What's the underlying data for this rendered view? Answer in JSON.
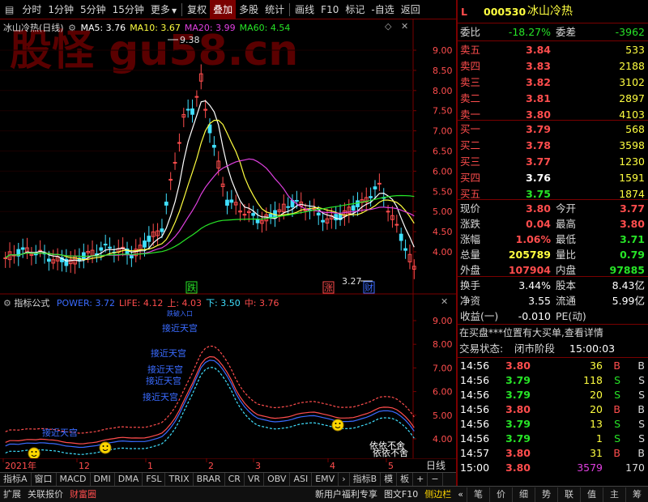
{
  "toolbar": {
    "items": [
      "分时",
      "1分钟",
      "5分钟",
      "15分钟",
      "更多",
      "复权",
      "叠加",
      "多股",
      "统计",
      "画线",
      "F10",
      "标记",
      "-自选",
      "返回"
    ],
    "active_index": 6
  },
  "main_chart": {
    "title": "冰山冷热(日线)",
    "ma": [
      {
        "label": "MA5: 3.76",
        "color": "#ffffff"
      },
      {
        "label": "MA10: 3.67",
        "color": "#ffff40"
      },
      {
        "label": "MA20: 3.99",
        "color": "#e040e0"
      },
      {
        "label": "MA60: 4.54",
        "color": "#27e427"
      }
    ],
    "y_ticks": [
      "9.00",
      "8.50",
      "8.00",
      "7.50",
      "7.00",
      "6.50",
      "6.00",
      "5.50",
      "5.00",
      "4.50",
      "4.00"
    ],
    "high_label": "9.38",
    "low_label": "3.27",
    "badges": [
      "跌",
      "涨",
      "财"
    ],
    "watermark": "股怪 gu58.cn"
  },
  "indicator_chart": {
    "title": "指标公式",
    "values": [
      {
        "label": "POWER: 3.72",
        "color": "#3a6bff"
      },
      {
        "label": "LIFE: 4.12",
        "color": "#ff4d4d"
      },
      {
        "label": "上: 4.03",
        "color": "#ff4d4d"
      },
      {
        "label": "下: 3.50",
        "color": "#40e0ff"
      },
      {
        "label": "中: 3.76",
        "color": "#ff4d4d"
      }
    ],
    "y_ticks": [
      "9.00",
      "8.00",
      "7.00",
      "6.00",
      "5.00",
      "4.00"
    ],
    "annotations": [
      "接近天宫",
      "接近天宫",
      "接近天宫",
      "接近天宫",
      "接近天宫",
      "接近天宫",
      "依依不舍",
      "依依不舍",
      "跌破入口"
    ]
  },
  "x_axis": {
    "labels": [
      "2021年",
      "12",
      "1",
      "2",
      "3",
      "4",
      "5"
    ],
    "mode": "日线"
  },
  "indicator_tabs": [
    "指标A",
    "窗口",
    "MACD",
    "DMI",
    "DMA",
    "FSL",
    "TRIX",
    "BRAR",
    "CR",
    "VR",
    "OBV",
    "ASI",
    "EMV",
    "›",
    "指标B",
    "模",
    "板",
    "+",
    "−"
  ],
  "bottom_bar": {
    "left": [
      "扩展",
      "关联报价",
      "财富圈"
    ],
    "right": [
      "新用户福利专享",
      "图文F10",
      "侧边栏",
      "«"
    ],
    "panel_tabs": [
      "笔",
      "价",
      "细",
      "势",
      "联",
      "值",
      "主",
      "筹"
    ]
  },
  "quote": {
    "marker": "L",
    "code": "000530",
    "name": "冰山冷热",
    "weibi": {
      "label": "委比",
      "value": "-18.27%"
    },
    "weicha": {
      "label": "委差",
      "value": "-3962"
    },
    "sell": [
      {
        "label": "卖五",
        "price": "3.84",
        "vol": "533"
      },
      {
        "label": "卖四",
        "price": "3.83",
        "vol": "2188"
      },
      {
        "label": "卖三",
        "price": "3.82",
        "vol": "3102"
      },
      {
        "label": "卖二",
        "price": "3.81",
        "vol": "2897"
      },
      {
        "label": "卖一",
        "price": "3.80",
        "vol": "4103"
      }
    ],
    "buy": [
      {
        "label": "买一",
        "price": "3.79",
        "vol": "568"
      },
      {
        "label": "买二",
        "price": "3.78",
        "vol": "3598"
      },
      {
        "label": "买三",
        "price": "3.77",
        "vol": "1230"
      },
      {
        "label": "买四",
        "price": "3.76",
        "vol": "1591"
      },
      {
        "label": "买五",
        "price": "3.75",
        "vol": "1874"
      }
    ],
    "stats": [
      {
        "l1": "现价",
        "v1": "3.80",
        "c1": "red",
        "l2": "今开",
        "v2": "3.77",
        "c2": "red"
      },
      {
        "l1": "涨跌",
        "v1": "0.04",
        "c1": "red",
        "l2": "最高",
        "v2": "3.80",
        "c2": "red"
      },
      {
        "l1": "涨幅",
        "v1": "1.06%",
        "c1": "red",
        "l2": "最低",
        "v2": "3.71",
        "c2": "green"
      },
      {
        "l1": "总量",
        "v1": "205789",
        "c1": "yellow",
        "l2": "量比",
        "v2": "0.79",
        "c2": "green"
      },
      {
        "l1": "外盘",
        "v1": "107904",
        "c1": "red",
        "l2": "内盘",
        "v2": "97885",
        "c2": "green"
      }
    ],
    "stats2": [
      {
        "l1": "换手",
        "v1": "3.44%",
        "l2": "股本",
        "v2": "8.43亿"
      },
      {
        "l1": "净资",
        "v1": "3.55",
        "l2": "流通",
        "v2": "5.99亿"
      },
      {
        "l1": "收益(一)",
        "v1": "-0.010",
        "l2": "PE(动)",
        "v2": ""
      }
    ],
    "notice": "在买盘***位置有大买单,查看详情",
    "trade_state_label": "交易状态:",
    "trade_state": "闭市阶段",
    "trade_time": "15:00:03",
    "ticks": [
      {
        "time": "14:56",
        "price": "3.80",
        "vol": "36",
        "bs": "B"
      },
      {
        "time": "14:56",
        "price": "3.79",
        "vol": "118",
        "bs": "S"
      },
      {
        "time": "14:56",
        "price": "3.79",
        "vol": "20",
        "bs": "S"
      },
      {
        "time": "14:56",
        "price": "3.80",
        "vol": "20",
        "bs": "B"
      },
      {
        "time": "14:56",
        "price": "3.79",
        "vol": "13",
        "bs": "S"
      },
      {
        "time": "14:56",
        "price": "3.79",
        "vol": "1",
        "bs": "S"
      },
      {
        "time": "14:57",
        "price": "3.80",
        "vol": "31",
        "bs": "B"
      },
      {
        "time": "15:00",
        "price": "3.80",
        "vol": "3579",
        "bs": "170"
      }
    ]
  }
}
